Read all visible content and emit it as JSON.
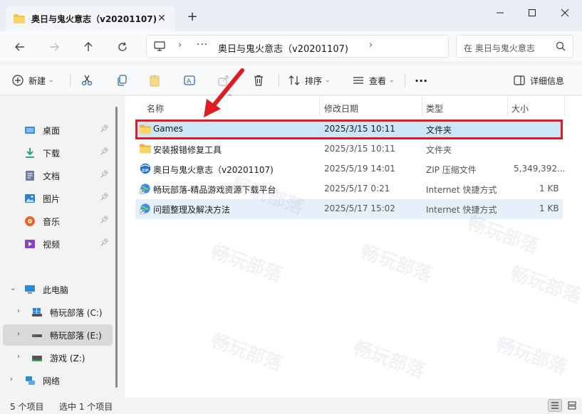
{
  "window": {
    "tab_title": "奥日与鬼火意志（v20201107)",
    "tab_close": "✕",
    "new_tab": "+"
  },
  "address": {
    "path": "奥日与鬼火意志（v20201107)",
    "more": "···",
    "chevron": "›"
  },
  "search": {
    "placeholder": "在 奥日与鬼火意志"
  },
  "toolbar": {
    "new_label": "新建",
    "sort_label": "排序",
    "view_label": "查看",
    "more": "···",
    "details_label": "详细信息"
  },
  "sidebar": {
    "quick": [
      {
        "label": "桌面",
        "icon": "desktop-icon"
      },
      {
        "label": "下载",
        "icon": "download-icon"
      },
      {
        "label": "文档",
        "icon": "document-icon"
      },
      {
        "label": "图片",
        "icon": "pictures-icon"
      },
      {
        "label": "音乐",
        "icon": "music-icon"
      },
      {
        "label": "视频",
        "icon": "video-icon"
      }
    ],
    "this_pc": "此电脑",
    "drives": [
      {
        "label": "畅玩部落 (C:)"
      },
      {
        "label": "畅玩部落 (E:)"
      },
      {
        "label": "游戏 (Z:)"
      }
    ],
    "network": "网络"
  },
  "columns": {
    "name": "名称",
    "modified": "修改日期",
    "type": "类型",
    "size": "大小"
  },
  "files": [
    {
      "name": "Games",
      "date": "2025/3/15 10:11",
      "type": "文件夹",
      "size": "",
      "icon": "folder-icon"
    },
    {
      "name": "安装报错修复工具",
      "date": "2025/3/15 10:11",
      "type": "文件夹",
      "size": "",
      "icon": "folder-icon"
    },
    {
      "name": "奥日与鬼火意志（v20201107)",
      "date": "2025/5/19 14:01",
      "type": "ZIP 压缩文件",
      "size": "5,349,392...",
      "icon": "zip-icon"
    },
    {
      "name": "畅玩部落-精品游戏资源下载平台",
      "date": "2025/5/17 0:21",
      "type": "Internet 快捷方式",
      "size": "1 KB",
      "icon": "internet-shortcut-icon"
    },
    {
      "name": "问题整理及解决方法",
      "date": "2025/5/17 15:02",
      "type": "Internet 快捷方式",
      "size": "1 KB",
      "icon": "internet-shortcut-icon"
    }
  ],
  "status": {
    "item_count": "5 个项目",
    "selected": "选中 1 个项目"
  },
  "watermark": "畅玩部落",
  "colors": {
    "accent": "#0067c0",
    "highlight_border": "#e01b24",
    "selected_row": "#cde6f7",
    "hover_row": "#e5f0fb",
    "folder": "#f5c242"
  }
}
